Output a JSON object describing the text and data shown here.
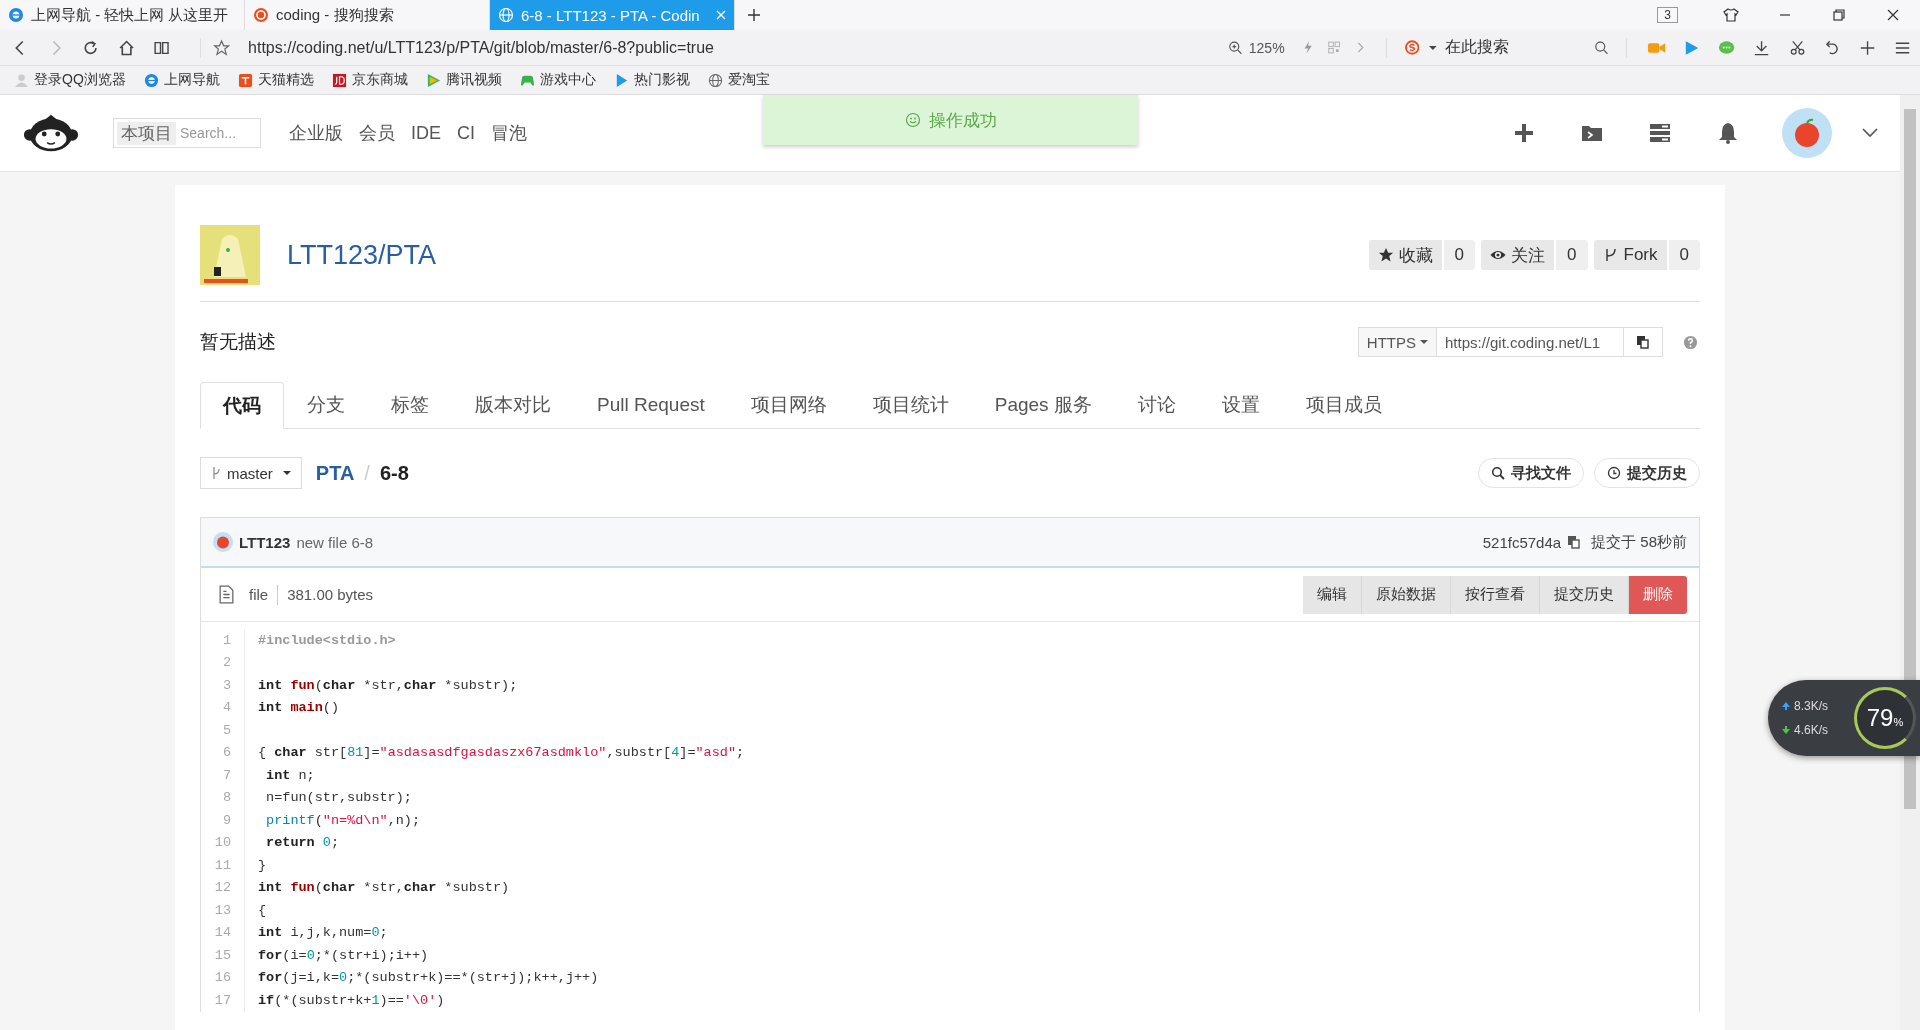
{
  "browser": {
    "tabs": [
      {
        "title": "上网导航 - 轻快上网 从这里开",
        "selected": false
      },
      {
        "title": "coding - 搜狗搜索",
        "selected": false
      },
      {
        "title": "6-8 - LTT123 - PTA - Codin",
        "selected": true
      }
    ],
    "tab_count": "3",
    "url": "https://coding.net/u/LTT123/p/PTA/git/blob/master/6-8?public=true",
    "zoom": "125%",
    "search_placeholder": "在此搜索",
    "bookmarks": [
      "登录QQ浏览器",
      "上网导航",
      "天猫精选",
      "京东商城",
      "腾讯视频",
      "游戏中心",
      "热门影视",
      "爱淘宝"
    ]
  },
  "site_header": {
    "search_scope": "本项目",
    "search_placeholder": "Search...",
    "nav": [
      "企业版",
      "会员",
      "IDE",
      "CI",
      "冒泡"
    ],
    "toast": "操作成功"
  },
  "repo": {
    "name": "LTT123/PTA",
    "actions": [
      {
        "label": "收藏",
        "count": "0"
      },
      {
        "label": "关注",
        "count": "0"
      },
      {
        "label": "Fork",
        "count": "0"
      }
    ],
    "description": "暂无描述",
    "clone": {
      "protocol": "HTTPS",
      "url": "https://git.coding.net/L1"
    },
    "tabs": [
      {
        "label": "代码",
        "selected": true
      },
      {
        "label": "分支",
        "selected": false
      },
      {
        "label": "标签",
        "selected": false
      },
      {
        "label": "版本对比",
        "selected": false
      },
      {
        "label": "Pull Request",
        "selected": false
      },
      {
        "label": "项目网络",
        "selected": false
      },
      {
        "label": "项目统计",
        "selected": false
      },
      {
        "label": "Pages 服务",
        "selected": false
      },
      {
        "label": "讨论",
        "selected": false
      },
      {
        "label": "设置",
        "selected": false
      },
      {
        "label": "项目成员",
        "selected": false
      }
    ],
    "branch": "master",
    "path": [
      "PTA",
      "6-8"
    ],
    "path_separator": "/",
    "tools": [
      "寻找文件",
      "提交历史"
    ],
    "commit": {
      "author": "LTT123",
      "message": "new file 6-8",
      "hash": "521fc57d4a",
      "time": "提交于 58秒前"
    },
    "file": {
      "type": "file",
      "size": "381.00 bytes"
    },
    "file_actions": [
      {
        "label": "编辑",
        "kind": "normal"
      },
      {
        "label": "原始数据",
        "kind": "normal"
      },
      {
        "label": "按行查看",
        "kind": "normal"
      },
      {
        "label": "提交历史",
        "kind": "normal"
      },
      {
        "label": "删除",
        "kind": "danger"
      }
    ],
    "code": [
      {
        "number": "1",
        "tokens": [
          {
            "kind": "pre",
            "text": "#include<stdio.h>"
          }
        ]
      },
      {
        "number": "2"
      },
      {
        "number": "3",
        "tokens": [
          {
            "kind": "kw",
            "text": "int"
          },
          {
            "kind": "fn",
            "text": " fun"
          },
          {
            "kind": "p",
            "text": "("
          },
          {
            "kind": "kw",
            "text": "char"
          },
          {
            "kind": "p",
            "text": " *str,"
          },
          {
            "kind": "kw",
            "text": "char"
          },
          {
            "kind": "p",
            "text": " *substr);"
          }
        ]
      },
      {
        "number": "4",
        "tokens": [
          {
            "kind": "kw",
            "text": "int"
          },
          {
            "kind": "fn",
            "text": " main"
          },
          {
            "kind": "p",
            "text": "()"
          }
        ]
      },
      {
        "number": "5"
      },
      {
        "number": "6",
        "tokens": [
          {
            "kind": "p",
            "text": "{ "
          },
          {
            "kind": "kw",
            "text": "char"
          },
          {
            "kind": "p",
            "text": " str["
          },
          {
            "kind": "num",
            "text": "81"
          },
          {
            "kind": "p",
            "text": "]="
          },
          {
            "kind": "str",
            "text": "\"asdasasdfgasdaszx67asdmklo\""
          },
          {
            "kind": "p",
            "text": ",substr["
          },
          {
            "kind": "num",
            "text": "4"
          },
          {
            "kind": "p",
            "text": "]="
          },
          {
            "kind": "str",
            "text": "\"asd\""
          },
          {
            "kind": "p",
            "text": ";"
          }
        ]
      },
      {
        "number": "7",
        "tokens": [
          {
            "kind": "kw",
            "text": " int"
          },
          {
            "kind": "p",
            "text": " n;"
          }
        ]
      },
      {
        "number": "8",
        "tokens": [
          {
            "kind": "p",
            "text": " n=fun(str,substr);"
          }
        ]
      },
      {
        "number": "9",
        "tokens": [
          {
            "kind": "builtin",
            "text": " printf"
          },
          {
            "kind": "p",
            "text": "("
          },
          {
            "kind": "str",
            "text": "\"n=%d\\n\""
          },
          {
            "kind": "p",
            "text": ",n);"
          }
        ]
      },
      {
        "number": "10",
        "tokens": [
          {
            "kind": "kw",
            "text": " return"
          },
          {
            "kind": "num",
            "text": " 0"
          },
          {
            "kind": "p",
            "text": ";"
          }
        ]
      },
      {
        "number": "11",
        "tokens": [
          {
            "kind": "p",
            "text": "}"
          }
        ]
      },
      {
        "number": "12",
        "tokens": [
          {
            "kind": "kw",
            "text": "int"
          },
          {
            "kind": "fn",
            "text": " fun"
          },
          {
            "kind": "p",
            "text": "("
          },
          {
            "kind": "kw",
            "text": "char"
          },
          {
            "kind": "p",
            "text": " *str,"
          },
          {
            "kind": "kw",
            "text": "char"
          },
          {
            "kind": "p",
            "text": " *substr)"
          }
        ]
      },
      {
        "number": "13",
        "tokens": [
          {
            "kind": "p",
            "text": "{"
          }
        ]
      },
      {
        "number": "14",
        "tokens": [
          {
            "kind": "kw",
            "text": "int"
          },
          {
            "kind": "p",
            "text": " i,j,k,num="
          },
          {
            "kind": "num",
            "text": "0"
          },
          {
            "kind": "p",
            "text": ";"
          }
        ]
      },
      {
        "number": "15",
        "tokens": [
          {
            "kind": "kw",
            "text": "for"
          },
          {
            "kind": "p",
            "text": "(i="
          },
          {
            "kind": "num",
            "text": "0"
          },
          {
            "kind": "p",
            "text": ";*(str+i);i++)"
          }
        ]
      },
      {
        "number": "16",
        "tokens": [
          {
            "kind": "kw",
            "text": "for"
          },
          {
            "kind": "p",
            "text": "(j=i,k="
          },
          {
            "kind": "num",
            "text": "0"
          },
          {
            "kind": "p",
            "text": ";*(substr+k)==*(str+j);k++,j++)"
          }
        ]
      },
      {
        "number": "17",
        "tokens": [
          {
            "kind": "kw",
            "text": "if"
          },
          {
            "kind": "p",
            "text": "(*(substr+k+"
          },
          {
            "kind": "num",
            "text": "1"
          },
          {
            "kind": "p",
            "text": ")=="
          },
          {
            "kind": "str",
            "text": "'\\0'"
          },
          {
            "kind": "p",
            "text": ")"
          }
        ]
      }
    ]
  },
  "speed_widget": {
    "upload": "8.3K/s",
    "download": "4.6K/s",
    "percent": "79",
    "unit": "%"
  }
}
